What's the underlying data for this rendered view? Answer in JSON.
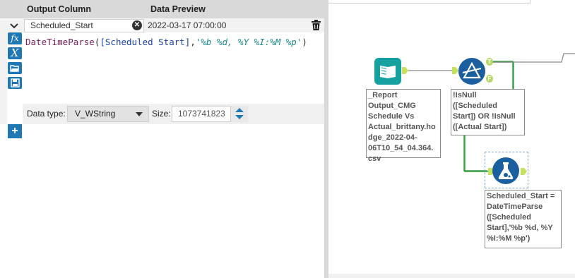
{
  "header": {
    "output_column": "Output Column",
    "data_preview": "Data Preview"
  },
  "field": {
    "name": "Scheduled_Start",
    "preview": "2022-03-17 07:00:00"
  },
  "expression": {
    "fn": "DateTimeParse",
    "open": "(",
    "field": "[Scheduled Start]",
    "comma": ",",
    "format": "'%b %d, %Y %I:%M %p'",
    "close": ")"
  },
  "datatype": {
    "label": "Data type:",
    "value": "V_WString",
    "size_label": "Size:",
    "size_value": "1073741823"
  },
  "canvas": {
    "input_label": "_Report\nOutput_CMG\nSchedule Vs\nActual_brittany.ho\ndge_2022-04-\n06T10_54_04.364.\ncsv",
    "filter_label": "!IsNull\n([Scheduled\nStart]) OR !IsNull\n([Actual Start])",
    "formula_label": "Scheduled_Start =\nDateTimeParse\n([Scheduled\nStart],'%b %d, %Y\n%I:%M %p')",
    "anchor_true": "T",
    "anchor_false": "F"
  },
  "colors": {
    "accent_blue": "#1f78b4",
    "connector_green": "#2e9e3e",
    "input_teal": "#16a0a0",
    "filter_blue": "#1b5f9e"
  }
}
